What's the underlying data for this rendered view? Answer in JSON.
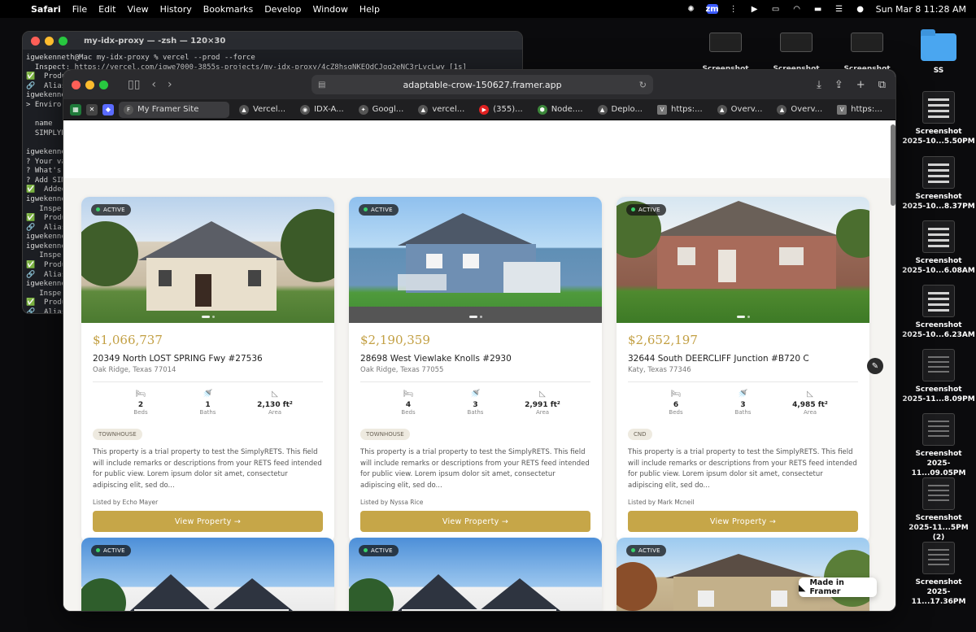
{
  "menubar": {
    "app": "Safari",
    "items": [
      "File",
      "Edit",
      "View",
      "History",
      "Bookmarks",
      "Develop",
      "Window",
      "Help"
    ],
    "datetime": "Sun Mar 8  11:28 AM",
    "zoom_label": "zm"
  },
  "terminal": {
    "title": "my-idx-proxy — -zsh — 120×30",
    "lines": [
      "igwekenneth@Mac my-idx-proxy % vercel --prod --force",
      "  Inspect: https://vercel.com/igwe7000-3855s-projects/my-idx-proxy/4cZ8hsqNKEQdCJqq2eNC3rLvcLwy [1s]",
      "✅  Produ",
      "🔗  Alias",
      "igwekenne",
      "> Enviro",
      "",
      "  name",
      "  SIMPLYRE",
      "",
      "igwekenne",
      "? Your va",
      "? What's",
      "? Add SIM",
      "✅  Added",
      "igwekenne",
      "   Inspe",
      "✅  Produ",
      "🔗  Alias",
      "igwekenne",
      "igwekenne",
      "   Inspe",
      "✅  Produ",
      "🔗  Alias",
      "igwekenne",
      "   Inspe",
      "✅  Produ",
      "🔗  Alias",
      "igwekenne"
    ]
  },
  "browser": {
    "url": "adaptable-crow-150627.framer.app",
    "tabs": [
      {
        "label": "My Framer Site",
        "icon": "F"
      },
      {
        "label": "Vercel...",
        "icon": "▲"
      },
      {
        "label": "IDX-A...",
        "icon": "◉"
      },
      {
        "label": "Googl...",
        "icon": "✦"
      },
      {
        "label": "vercel...",
        "icon": "▲"
      },
      {
        "label": "(355)...",
        "icon": "▶"
      },
      {
        "label": "Node....",
        "icon": "⬢"
      },
      {
        "label": "Deplo...",
        "icon": "▲"
      },
      {
        "label": "https:...",
        "icon": "V"
      },
      {
        "label": "Overv...",
        "icon": "▲"
      },
      {
        "label": "Overv...",
        "icon": "▲"
      },
      {
        "label": "https:...",
        "icon": "V"
      }
    ]
  },
  "listings": [
    {
      "status": "ACTIVE",
      "price": "$1,066,737",
      "address": "20349 North LOST SPRING Fwy #27536",
      "city": "Oak Ridge, Texas 77014",
      "beds": "2",
      "beds_label": "Beds",
      "baths": "1",
      "baths_label": "Baths",
      "area": "2,130 ft²",
      "area_label": "Area",
      "type": "TOWNHOUSE",
      "description": "This property is a trial property to test the SimplyRETS. This field will include remarks or descriptions from your RETS feed intended for public view. Lorem ipsum dolor sit amet, consectetur adipiscing elit, sed do...",
      "listed_by": "Listed by Echo Mayer",
      "cta": "View Property →"
    },
    {
      "status": "ACTIVE",
      "price": "$2,190,359",
      "address": "28698 West Viewlake Knolls #2930",
      "city": "Oak Ridge, Texas 77055",
      "beds": "4",
      "beds_label": "Beds",
      "baths": "3",
      "baths_label": "Baths",
      "area": "2,991 ft²",
      "area_label": "Area",
      "type": "TOWNHOUSE",
      "description": "This property is a trial property to test the SimplyRETS. This field will include remarks or descriptions from your RETS feed intended for public view. Lorem ipsum dolor sit amet, consectetur adipiscing elit, sed do...",
      "listed_by": "Listed by Nyssa Rice",
      "cta": "View Property →"
    },
    {
      "status": "ACTIVE",
      "price": "$2,652,197",
      "address": "32644 South DEERCLIFF Junction #B720 C",
      "city": "Katy, Texas 77346",
      "beds": "6",
      "beds_label": "Beds",
      "baths": "3",
      "baths_label": "Baths",
      "area": "4,985 ft²",
      "area_label": "Area",
      "type": "CND",
      "description": "This property is a trial property to test the SimplyRETS. This field will include remarks or descriptions from your RETS feed intended for public view. Lorem ipsum dolor sit amet, consectetur adipiscing elit, sed do...",
      "listed_by": "Listed by Mark Mcneil",
      "cta": "View Property →"
    }
  ],
  "lower_listings": [
    {
      "status": "ACTIVE"
    },
    {
      "status": "ACTIVE"
    },
    {
      "status": "ACTIVE"
    }
  ],
  "framer_badge": "Made in Framer",
  "desktop": {
    "folder_label": "SS",
    "top_labels": [
      "Screenshot",
      "Screenshot",
      "Screenshot"
    ],
    "files": [
      {
        "line1": "Screenshot",
        "line2": "2025-10...5.50PM"
      },
      {
        "line1": "Screenshot",
        "line2": "2025-10...8.37PM"
      },
      {
        "line1": "Screenshot",
        "line2": "2025-10...6.08AM"
      },
      {
        "line1": "Screenshot",
        "line2": "2025-10...6.23AM"
      },
      {
        "line1": "Screenshot",
        "line2": "2025-11...8.09PM"
      },
      {
        "line1": "Screenshot",
        "line2": "2025-11...09.05PM"
      },
      {
        "line1": "Screenshot",
        "line2": "2025-11...5PM (2)"
      },
      {
        "line1": "Screenshot",
        "line2": "2025-11...17.36PM"
      }
    ]
  }
}
